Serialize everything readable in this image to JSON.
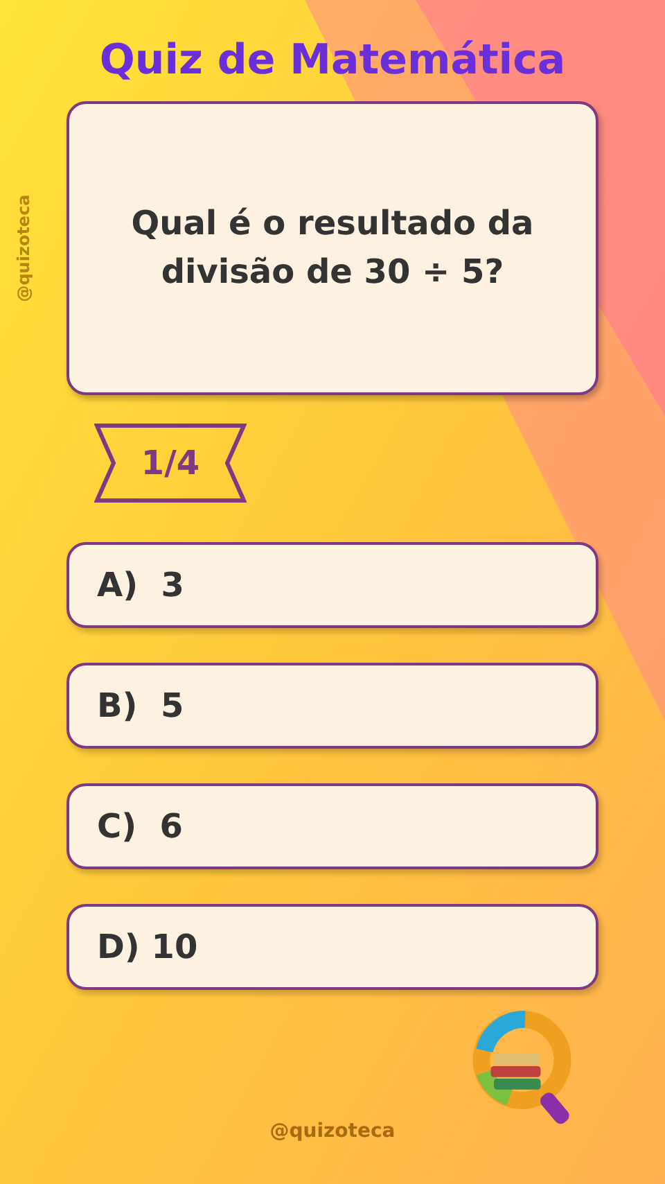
{
  "title": "Quiz de Matemática",
  "question": "Qual é o resultado da divisão de 30 ÷ 5?",
  "progress": "1/4",
  "options": [
    {
      "label": "A)  3"
    },
    {
      "label": "B)  5"
    },
    {
      "label": "C)  6"
    },
    {
      "label": "D) 10"
    }
  ],
  "side_handle": "@quizoteca",
  "footer_handle": "@quizoteca"
}
